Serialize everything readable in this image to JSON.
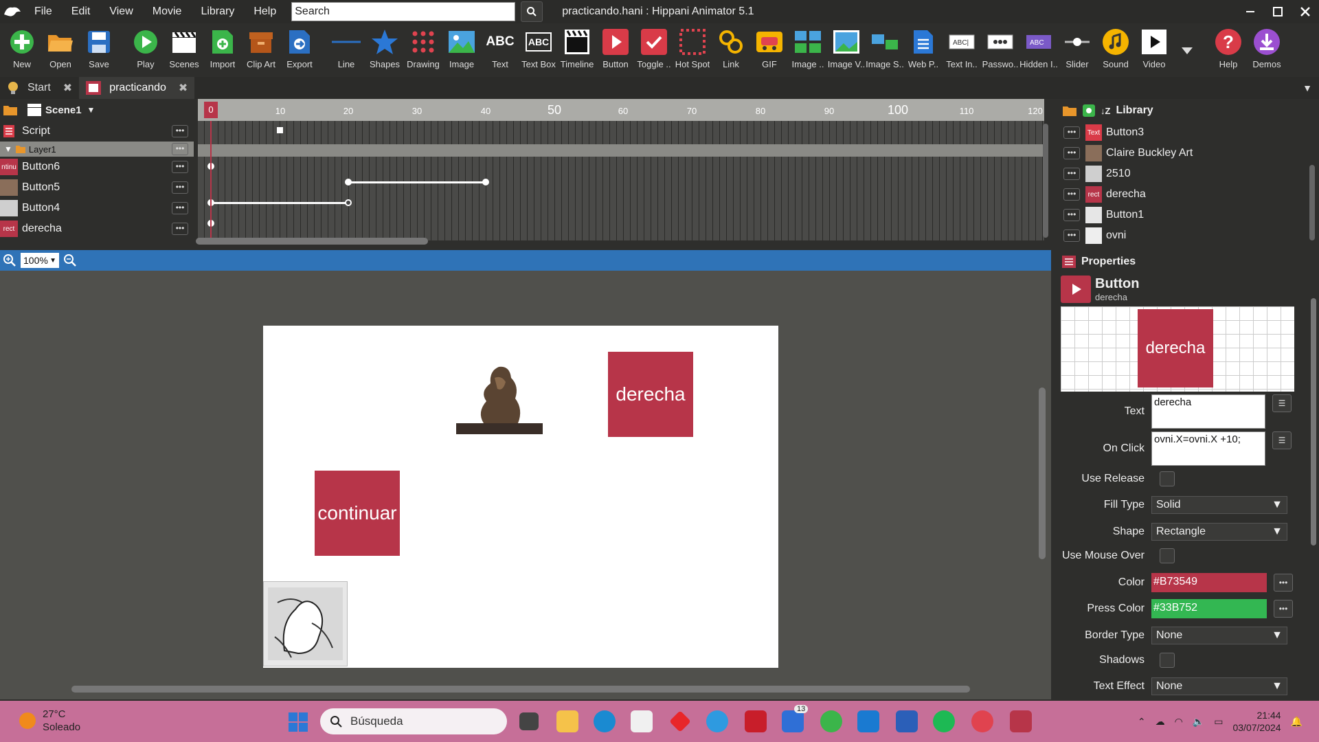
{
  "app": {
    "window_title": "practicando.hani : Hippani Animator 5.1",
    "menu": [
      "File",
      "Edit",
      "View",
      "Movie",
      "Library",
      "Help"
    ],
    "search": {
      "placeholder": "Search",
      "value": "Search"
    }
  },
  "toolbar": {
    "items": [
      {
        "label": "New",
        "icon": "new-icon"
      },
      {
        "label": "Open",
        "icon": "open-folder-icon"
      },
      {
        "label": "Save",
        "icon": "save-icon"
      },
      {
        "label": "Play",
        "icon": "play-icon"
      },
      {
        "label": "Scenes",
        "icon": "clapperboard-icon"
      },
      {
        "label": "Import",
        "icon": "import-icon"
      },
      {
        "label": "Clip Art",
        "icon": "clip-art-icon"
      },
      {
        "label": "Export",
        "icon": "export-icon"
      },
      {
        "label": "Line",
        "icon": "line-icon"
      },
      {
        "label": "Shapes",
        "icon": "star-icon"
      },
      {
        "label": "Drawing",
        "icon": "drawing-icon"
      },
      {
        "label": "Image",
        "icon": "image-icon"
      },
      {
        "label": "Text",
        "icon": "text-icon"
      },
      {
        "label": "Text Box",
        "icon": "text-box-icon"
      },
      {
        "label": "Timeline",
        "icon": "timeline-icon"
      },
      {
        "label": "Button",
        "icon": "button-icon"
      },
      {
        "label": "Toggle ..",
        "icon": "toggle-icon"
      },
      {
        "label": "Hot Spot",
        "icon": "hot-spot-icon"
      },
      {
        "label": "Link",
        "icon": "link-icon"
      },
      {
        "label": "GIF",
        "icon": "gif-icon"
      },
      {
        "label": "Image ..",
        "icon": "image-gallery-icon"
      },
      {
        "label": "Image V..",
        "icon": "image-viewer-icon"
      },
      {
        "label": "Image S..",
        "icon": "image-slider-icon"
      },
      {
        "label": "Web P..",
        "icon": "web-page-icon"
      },
      {
        "label": "Text In..",
        "icon": "text-input-icon"
      },
      {
        "label": "Passwo..",
        "icon": "password-icon"
      },
      {
        "label": "Hidden I..",
        "icon": "hidden-input-icon"
      },
      {
        "label": "Slider",
        "icon": "slider-icon"
      },
      {
        "label": "Sound",
        "icon": "sound-icon"
      },
      {
        "label": "Video",
        "icon": "video-icon"
      },
      {
        "label": "Help",
        "icon": "help-icon"
      },
      {
        "label": "Demos",
        "icon": "demos-icon"
      }
    ]
  },
  "tabs": [
    {
      "label": "Start"
    },
    {
      "label": "practicando"
    }
  ],
  "timeline": {
    "scene": "Scene1",
    "layers": [
      {
        "name": "Script",
        "thumb": ""
      },
      {
        "name": "Layer1",
        "thumb": ""
      },
      {
        "name": "Button6",
        "thumb": "ntinu"
      },
      {
        "name": "Button5",
        "thumb": ""
      },
      {
        "name": "Button4",
        "thumb": ""
      },
      {
        "name": "derecha",
        "thumb": "rect"
      }
    ],
    "ruler_labels": [
      "0",
      "10",
      "20",
      "30",
      "40",
      "50",
      "60",
      "70",
      "80",
      "90",
      "100",
      "110",
      "120"
    ],
    "current_frame": "0"
  },
  "library": {
    "title": "Library",
    "items": [
      {
        "name": "Button3",
        "thumb": "Text"
      },
      {
        "name": "Claire Buckley Art",
        "thumb": ""
      },
      {
        "name": "2510",
        "thumb": ""
      },
      {
        "name": "derecha",
        "thumb": "rect"
      },
      {
        "name": "Button1",
        "thumb": ""
      },
      {
        "name": "ovni",
        "thumb": ""
      }
    ]
  },
  "stage": {
    "zoom": "100%",
    "buttons": {
      "right": "derecha",
      "continue": "continuar"
    }
  },
  "properties": {
    "title": "Properties",
    "type": "Button",
    "object_name": "derecha",
    "preview_text": "derecha",
    "fields": {
      "text_label": "Text",
      "text_value": "derecha",
      "onclick_label": "On Click",
      "onclick_value": "ovni.X=ovni.X +10;",
      "use_release_label": "Use Release",
      "fill_type_label": "Fill Type",
      "fill_type_value": "Solid",
      "shape_label": "Shape",
      "shape_value": "Rectangle",
      "use_mouse_over_label": "Use Mouse Over",
      "color_label": "Color",
      "color_value": "#B73549",
      "press_color_label": "Press Color",
      "press_color_value": "#33B752",
      "border_type_label": "Border Type",
      "border_type_value": "None",
      "shadows_label": "Shadows",
      "text_effect_label": "Text Effect",
      "text_effect_value": "None"
    }
  },
  "taskbar": {
    "weather_temp": "27°C",
    "weather_desc": "Soleado",
    "search_label": "Búsqueda",
    "badge_count": "13",
    "time": "21:44",
    "date": "03/07/2024"
  },
  "colors": {
    "accent": "#b73549",
    "press": "#33b752",
    "stage_bar": "#2f73b7",
    "taskbar": "#c66f98"
  }
}
